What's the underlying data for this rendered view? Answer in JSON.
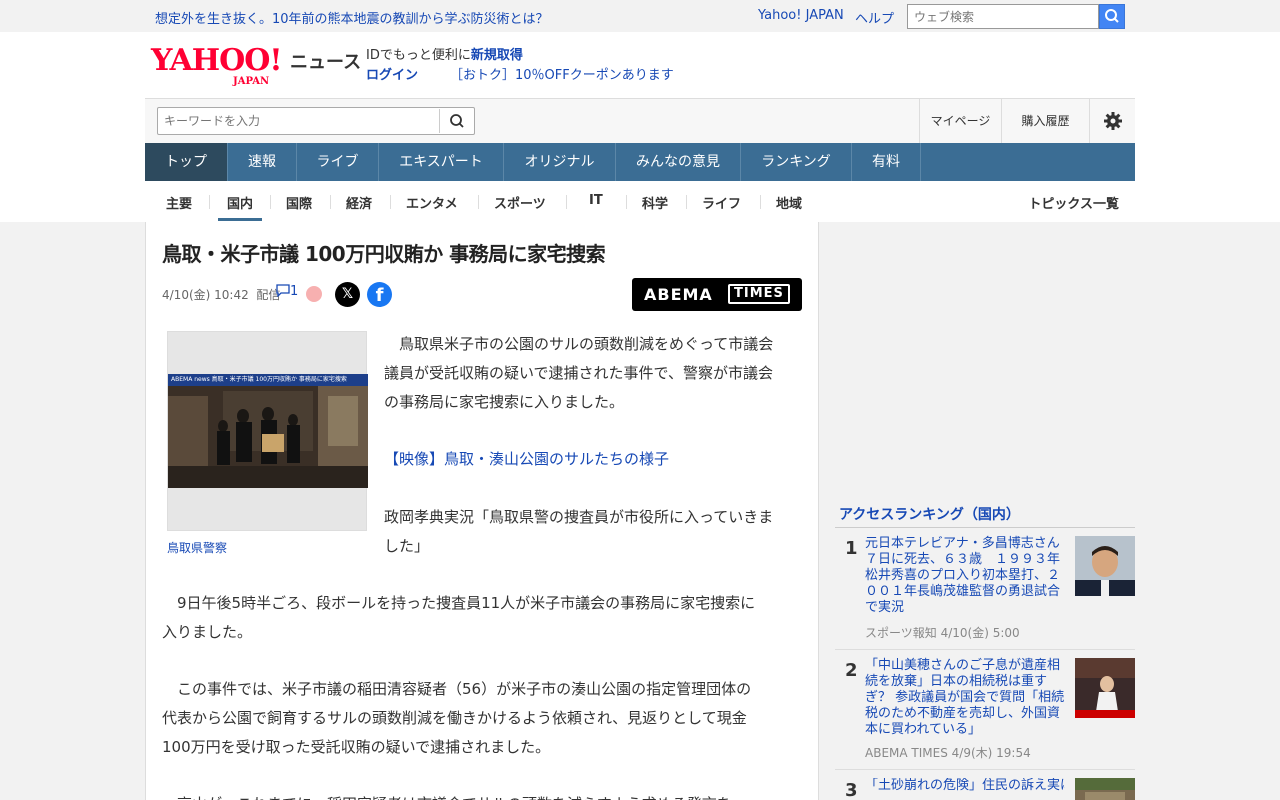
{
  "topbar": {
    "promo": "想定外を生き抜く。10年前の熊本地震の教訓から学ぶ防災術とは？",
    "yahoo_japan": "Yahoo! JAPAN",
    "help": "ヘルプ",
    "search_placeholder": "ウェブ検索"
  },
  "header": {
    "logo_main": "YAHOO!",
    "logo_sub": "JAPAN",
    "logo_news": "ニュース",
    "id_text": "IDでもっと便利に",
    "signup": "新規取得",
    "login": "ログイン",
    "coupon": "［おトク］10％OFFクーポンあります",
    "keyword_placeholder": "キーワードを入力",
    "mypage": "マイページ",
    "purchase_history": "購入履歴"
  },
  "main_nav": [
    "トップ",
    "速報",
    "ライブ",
    "エキスパート",
    "オリジナル",
    "みんなの意見",
    "ランキング",
    "有料"
  ],
  "sub_nav": [
    "主要",
    "国内",
    "国際",
    "経済",
    "エンタメ",
    "スポーツ",
    "IT",
    "科学",
    "ライフ",
    "地域"
  ],
  "sub_nav_active": "国内",
  "topics_all": "トピックス一覧",
  "article": {
    "title": "鳥取・米子市議 100万円収賄か 事務局に家宅捜索",
    "date": "4/10(金) 10:42",
    "published": "配信",
    "comments": "1",
    "source_logo_1": "ABEMA",
    "source_logo_2": "TIMES",
    "photo_band": "ABEMA news 鳥取・米子市議 100万円収賄か 事務局に家宅捜索",
    "photo_caption": "鳥取県警察",
    "para1_lines": [
      "　鳥取県米子市の公園のサルの頭数削減をめぐって市議会",
      "議員が受託収賄の疑いで逮捕された事件で、警察が市議会",
      "の事務局に家宅捜索に入りました。"
    ],
    "video_link": "【映像】鳥取・湊山公園のサルたちの様子",
    "para2_lines": [
      "政岡孝典実況「鳥取県警の捜査員が市役所に入っていきま",
      "した」"
    ],
    "para3_lines": [
      "　9日午後5時半ごろ、段ボールを持った捜査員11人が米子市議会の事務局に家宅捜索に",
      "入りました。"
    ],
    "para4_lines": [
      "　この事件では、米子市議の稲田清容疑者（56）が米子市の湊山公園の指定管理団体の",
      "代表から公園で飼育するサルの頭数削減を働きかけるよう依頼され、見返りとして現金",
      "100万円を受け取った受託収賄の疑いで逮捕されました。"
    ],
    "para5_partial": "　高山が　これまでに　稲田容疑者は市議会でサルの頭数を減らすよう求める発言を"
  },
  "ranking": {
    "heading": "アクセスランキング（国内）",
    "items": [
      {
        "rank": "1",
        "title": "元日本テレビアナ・多昌博志さん７日に死去、６３歳　１９９３年松井秀喜のプロ入り初本塁打、２００１年長嶋茂雄監督の勇退試合で実況",
        "source": "スポーツ報知 4/10(金) 5:00"
      },
      {
        "rank": "2",
        "title": "「中山美穂さんのご子息が遺産相続を放棄」日本の相続税は重すぎ？ 参政議員が国会で質問「相続税のため不動産を売却し、外国資本に買われている」",
        "source": "ABEMA TIMES 4/9(木) 19:54"
      },
      {
        "rank": "3",
        "title": "「土砂崩れの危険」住民の訴え実は…治谷区…",
        "source": ""
      }
    ]
  },
  "colors": {
    "nav_blue": "#3b6d94",
    "nav_active": "#2d4a5e",
    "link_blue": "#1749b5",
    "logo_red": "#ff0033"
  }
}
